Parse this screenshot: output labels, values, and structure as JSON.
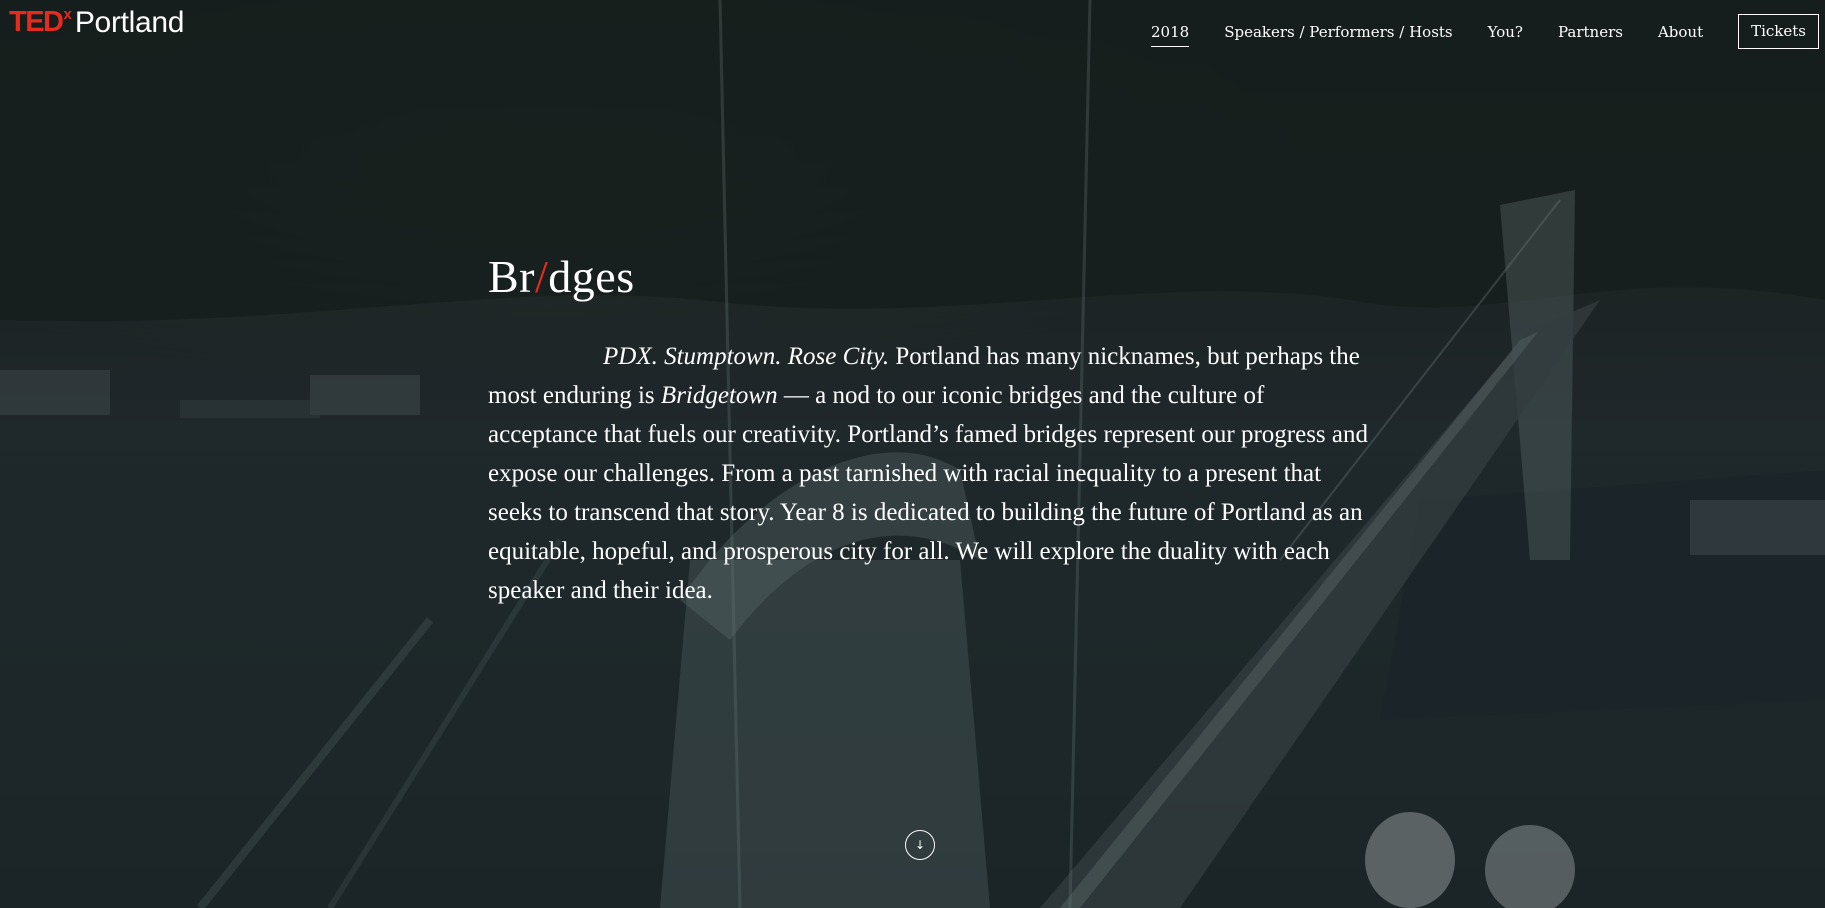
{
  "header": {
    "logo": {
      "ted": "TED",
      "x": "x",
      "city": "Portland"
    },
    "nav": [
      {
        "label": "2018",
        "active": true
      },
      {
        "label": "Speakers / Performers / Hosts"
      },
      {
        "label": "You?"
      },
      {
        "label": "Partners"
      },
      {
        "label": "About"
      }
    ],
    "tickets_label": "Tickets"
  },
  "hero": {
    "title_start": "Br",
    "title_slash": "/",
    "title_end": "dges",
    "intro": {
      "italic_1": "PDX. Stumptown. Rose City.",
      "text_1": " Portland has many nicknames, but perhaps the most enduring is ",
      "italic_2": "Bridgetown",
      "text_2": " — a nod to our iconic bridges and the culture of acceptance that fuels our creativity. Portland’s famed bridges represent our progress and expose our challenges. From a past tarnished with racial inequality to a present that seeks to transcend that story. Year 8 is dedicated to building the future of Portland as an equitable, hopeful, and prosperous city for all. We will explore the duality with each speaker and their idea."
    },
    "scroll_icon": "arrow-down-icon",
    "scroll_glyph": "↓"
  },
  "colors": {
    "accent": "#e62b1e",
    "text": "#ffffff"
  }
}
